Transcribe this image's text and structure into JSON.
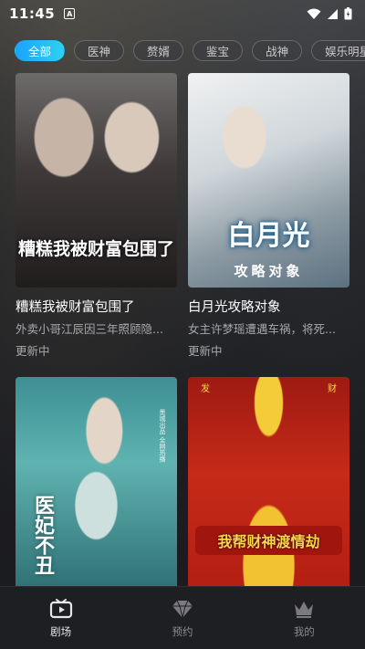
{
  "status_bar": {
    "time": "11:45",
    "notification_letter": "A"
  },
  "tabs": [
    {
      "label": "全部",
      "active": true
    },
    {
      "label": "医神",
      "active": false
    },
    {
      "label": "赘婿",
      "active": false
    },
    {
      "label": "鉴宝",
      "active": false
    },
    {
      "label": "战神",
      "active": false
    },
    {
      "label": "娱乐明星",
      "active": false
    }
  ],
  "cards": [
    {
      "poster_text": "糟糕我被财富包围了",
      "title": "糟糕我被财富包围了",
      "desc": "外卖小哥江辰因三年照顾隐...",
      "status": "更新中"
    },
    {
      "poster_text": "白月光",
      "poster_sub": "攻略对象",
      "title": "白月光攻略对象",
      "desc": "女主许梦瑶遭遇车祸，将死...",
      "status": "更新中"
    },
    {
      "poster_text": "医妃不丑",
      "poster_side": "墨城出品 全网热播"
    },
    {
      "poster_text": "我帮财神渡情劫",
      "corner_left": "发",
      "corner_right": "财"
    }
  ],
  "bottom_nav": [
    {
      "label": "剧场",
      "icon": "tv-play-icon",
      "active": true
    },
    {
      "label": "预约",
      "icon": "diamond-icon",
      "active": false
    },
    {
      "label": "我的",
      "icon": "crown-icon",
      "active": false
    }
  ],
  "colors": {
    "accent_gradient_start": "#1aa3ff",
    "accent_gradient_end": "#2bd2f0",
    "background": "#1d1e22"
  }
}
